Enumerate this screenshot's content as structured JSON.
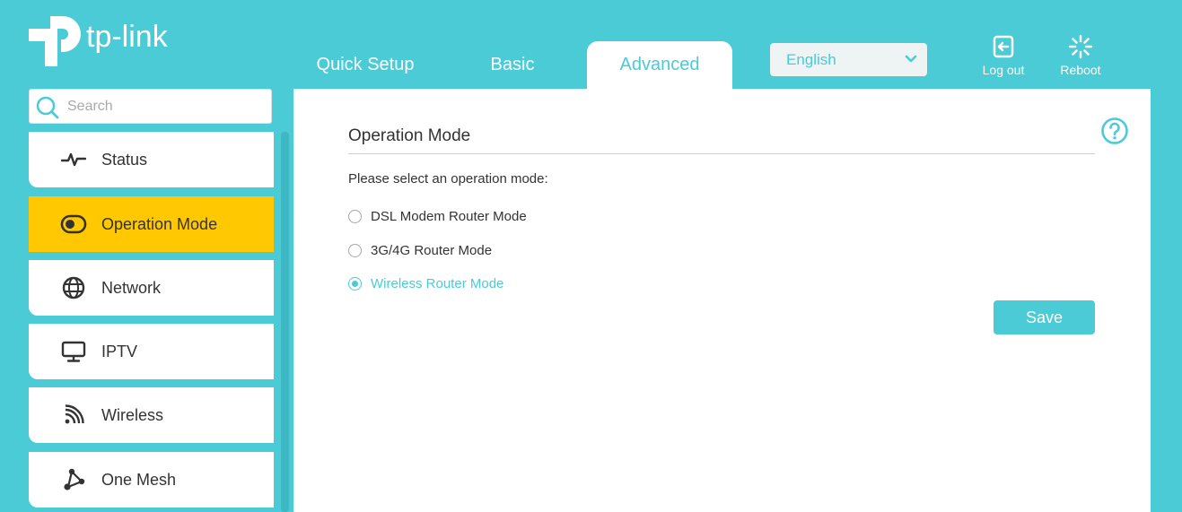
{
  "brand": {
    "logo_text": "tp-link"
  },
  "nav": {
    "tabs": [
      {
        "label": "Quick Setup",
        "active": false
      },
      {
        "label": "Basic",
        "active": false
      },
      {
        "label": "Advanced",
        "active": true
      }
    ]
  },
  "language": {
    "selected": "English"
  },
  "actions": {
    "logout_label": "Log out",
    "reboot_label": "Reboot"
  },
  "search": {
    "placeholder": "Search"
  },
  "sidebar": {
    "items": [
      {
        "label": "Status",
        "icon": "pulse-icon",
        "active": false
      },
      {
        "label": "Operation Mode",
        "icon": "toggle-icon",
        "active": true
      },
      {
        "label": "Network",
        "icon": "globe-icon",
        "active": false
      },
      {
        "label": "IPTV",
        "icon": "monitor-icon",
        "active": false
      },
      {
        "label": "Wireless",
        "icon": "wifi-icon",
        "active": false
      },
      {
        "label": "One Mesh",
        "icon": "mesh-icon",
        "active": false
      }
    ]
  },
  "main": {
    "title": "Operation Mode",
    "prompt": "Please select an operation mode:",
    "options": [
      {
        "label": "DSL Modem Router Mode",
        "selected": false
      },
      {
        "label": "3G/4G Router Mode",
        "selected": false
      },
      {
        "label": "Wireless Router Mode",
        "selected": true
      }
    ],
    "save_label": "Save"
  },
  "colors": {
    "accent": "#4acbd6",
    "active_item": "#ffc800"
  }
}
